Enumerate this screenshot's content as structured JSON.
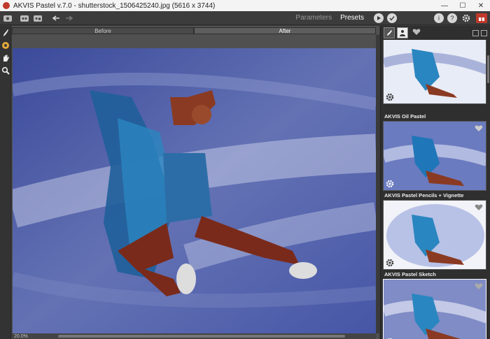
{
  "window": {
    "title": "AKVIS Pastel v.7.0 - shutterstock_1506425240.jpg (5616 x 3744)",
    "minimize": "—",
    "maximize": "☐",
    "close": "✕"
  },
  "toolbar": {
    "parameters_label": "Parameters",
    "presets_label": "Presets",
    "info_symbol": "i",
    "help_symbol": "?"
  },
  "canvas": {
    "tab_before": "Before",
    "tab_after": "After",
    "zoom": "20.0%"
  },
  "presets": [
    {
      "name": "",
      "selected": false
    },
    {
      "name": "AKVIS Oil Pastel",
      "selected": false
    },
    {
      "name": "AKVIS Pastel Pencils + Vignette",
      "selected": false
    },
    {
      "name": "AKVIS Pastel Sketch",
      "selected": true
    }
  ],
  "colors": {
    "accent_red": "#c0392b",
    "sky_blue": "#5262a8"
  }
}
